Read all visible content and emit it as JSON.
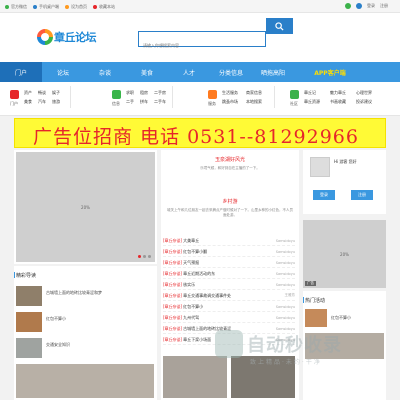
{
  "topbar": {
    "links": [
      "官方微信",
      "手机桌户端",
      "设为首页",
      "收藏本站"
    ],
    "login": "登录",
    "register": "注册",
    "colors": {
      "wechat": "#3bb24a",
      "mobile": "#2a7fc9",
      "home": "#ff9a1f",
      "fav": "#e6262a"
    }
  },
  "header": {
    "logo_text": "章丘论坛",
    "search_placeholder": "请输入你想搜索内容"
  },
  "nav": {
    "items": [
      "门户",
      "论坛",
      "杂谈",
      "美食",
      "人才",
      "分类信息",
      "晒拖高阳"
    ],
    "app": "APP客户端"
  },
  "subnav": {
    "groups": [
      {
        "icon": "门户",
        "color": "#e6262a",
        "links": [
          "资产",
          "畅谈",
          "娱子",
          "美食",
          "汽车",
          "旅游"
        ]
      },
      {
        "icon": "信息",
        "color": "#39b54a",
        "links": [
          "求职",
          "租房",
          "二手房",
          "二手",
          "拼车",
          "二手车"
        ]
      },
      {
        "icon": "服务",
        "color": "#ff7a1f",
        "links": [
          "生活服务",
          "商家信息",
          "跳蚤市场",
          "本地搜索"
        ]
      },
      {
        "icon": "社区",
        "color": "#3bb24a",
        "links": [
          "章丘记",
          "魅力章丘",
          "心理世界",
          "章丘资源",
          "书画收藏",
          "投诉建议"
        ]
      }
    ]
  },
  "banner": {
    "text": "广告位招商  电话 0531--81292966"
  },
  "slider": {
    "placeholder": "20%"
  },
  "hot_reads": {
    "title": "精彩导读",
    "items": [
      "古城墙上面的地砖比较青涩和梦",
      "红包不算小",
      "交通安全知识"
    ]
  },
  "center": {
    "h1": "玉泉湖好风光",
    "desc1": "乐境气候，和好到自在主播的了一下。",
    "h2": "乡村游",
    "desc2": "城关上午和几位朋友一起去采摘点产做时候对了一下。山里乡种的小红色，不人员面处游。",
    "rows": [
      {
        "tag": "[章丘杂谈]",
        "title": "大美章丘",
        "user": "Samsidoyu"
      },
      {
        "tag": "[章丘杂谈]",
        "title": "红包不算小翻",
        "user": "Samsidoyu"
      },
      {
        "tag": "[章丘杂谈]",
        "title": "天气预报",
        "user": "Samsidoyu"
      },
      {
        "tag": "[章丘杂谈]",
        "title": "章丘近期活动的东",
        "user": "Samsidoyu"
      },
      {
        "tag": "[章丘杂谈]",
        "title": "核实乐",
        "user": "Samsidoyu"
      },
      {
        "tag": "[章丘杂谈]",
        "title": "章丘交通事故调交通事件处",
        "user": "王雅芳"
      },
      {
        "tag": "[章丘杂谈]",
        "title": "红包不算小",
        "user": "Samsidoyu"
      },
      {
        "tag": "[章丘杂谈]",
        "title": "九州代驾",
        "user": "Samsidoyu"
      },
      {
        "tag": "[章丘杂谈]",
        "title": "古城墙上面的地砖比较青涩",
        "user": "Samsidoyu"
      },
      {
        "tag": "[章丘杂谈]",
        "title": "章丘下浆小场面",
        "user": "Samsidoyu"
      }
    ]
  },
  "right": {
    "greeting": "Hi 游客 您好",
    "login": "登录",
    "register": "注册",
    "ph": "20%",
    "ph_tag": "广告",
    "hot_title": "热门活动",
    "hot_item": "红包不算小"
  },
  "watermark": {
    "text": "自动秒收录",
    "sub": "致上精品·未约·干净"
  }
}
